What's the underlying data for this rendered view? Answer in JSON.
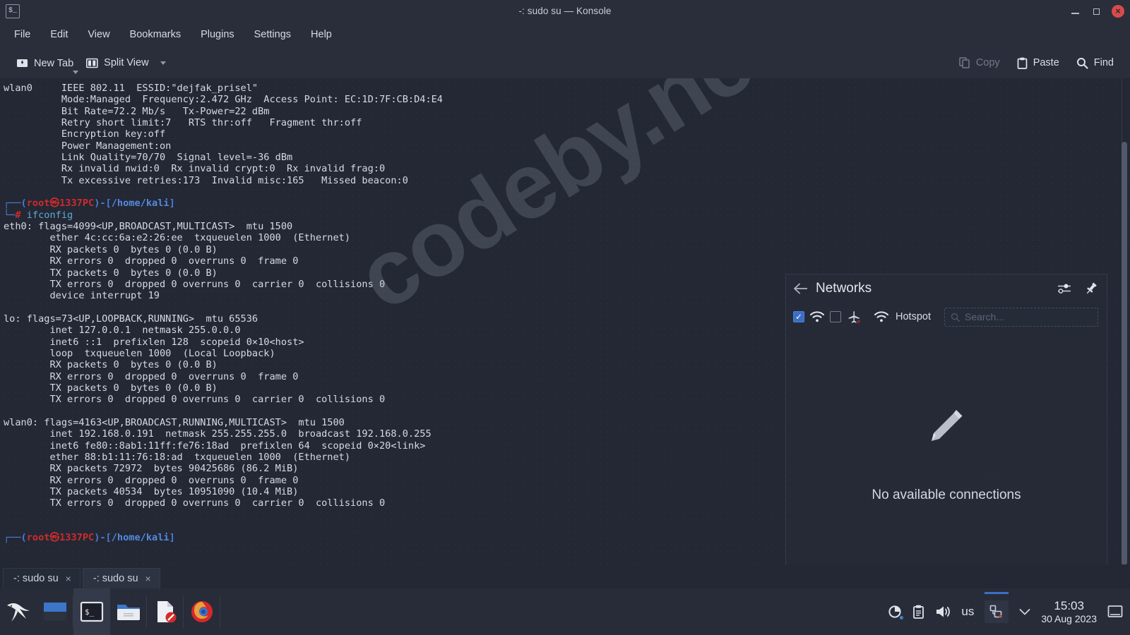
{
  "window": {
    "app_icon": "terminal-icon",
    "title": "-: sudo su — Konsole",
    "minimize": "–",
    "maximize": "□",
    "close": "×"
  },
  "menubar": {
    "items": [
      {
        "label": "File"
      },
      {
        "label": "Edit"
      },
      {
        "label": "View"
      },
      {
        "label": "Bookmarks"
      },
      {
        "label": "Plugins"
      },
      {
        "label": "Settings"
      },
      {
        "label": "Help"
      }
    ]
  },
  "toolbar": {
    "new_tab": "New Tab",
    "split_view": "Split View",
    "copy": "Copy",
    "paste": "Paste",
    "find": "Find"
  },
  "terminal": {
    "lines": [
      {
        "text": "wlan0     IEEE 802.11  ESSID:\"dejfak_prisel\"  "
      },
      {
        "text": "          Mode:Managed  Frequency:2.472 GHz  Access Point: EC:1D:7F:CB:D4:E4   "
      },
      {
        "text": "          Bit Rate=72.2 Mb/s   Tx-Power=22 dBm   "
      },
      {
        "text": "          Retry short limit:7   RTS thr:off   Fragment thr:off"
      },
      {
        "text": "          Encryption key:off"
      },
      {
        "text": "          Power Management:on"
      },
      {
        "text": "          Link Quality=70/70  Signal level=-36 dBm  "
      },
      {
        "text": "          Rx invalid nwid:0  Rx invalid crypt:0  Rx invalid frag:0"
      },
      {
        "text": "          Tx excessive retries:173  Invalid misc:165   Missed beacon:0"
      },
      {
        "text": ""
      },
      {
        "text": "PROMPT1"
      },
      {
        "text": "PROMPT2"
      },
      {
        "text": "eth0: flags=4099<UP,BROADCAST,MULTICAST>  mtu 1500"
      },
      {
        "text": "        ether 4c:cc:6a:e2:26:ee  txqueuelen 1000  (Ethernet)"
      },
      {
        "text": "        RX packets 0  bytes 0 (0.0 B)"
      },
      {
        "text": "        RX errors 0  dropped 0  overruns 0  frame 0"
      },
      {
        "text": "        TX packets 0  bytes 0 (0.0 B)"
      },
      {
        "text": "        TX errors 0  dropped 0 overruns 0  carrier 0  collisions 0"
      },
      {
        "text": "        device interrupt 19  "
      },
      {
        "text": ""
      },
      {
        "text": "lo: flags=73<UP,LOOPBACK,RUNNING>  mtu 65536"
      },
      {
        "text": "        inet 127.0.0.1  netmask 255.0.0.0"
      },
      {
        "text": "        inet6 ::1  prefixlen 128  scopeid 0×10<host>"
      },
      {
        "text": "        loop  txqueuelen 1000  (Local Loopback)"
      },
      {
        "text": "        RX packets 0  bytes 0 (0.0 B)"
      },
      {
        "text": "        RX errors 0  dropped 0  overruns 0  frame 0"
      },
      {
        "text": "        TX packets 0  bytes 0 (0.0 B)"
      },
      {
        "text": "        TX errors 0  dropped 0 overruns 0  carrier 0  collisions 0"
      },
      {
        "text": ""
      },
      {
        "text": "wlan0: flags=4163<UP,BROADCAST,RUNNING,MULTICAST>  mtu 1500"
      },
      {
        "text": "        inet 192.168.0.191  netmask 255.255.255.0  broadcast 192.168.0.255"
      },
      {
        "text": "        inet6 fe80::8ab1:11ff:fe76:18ad  prefixlen 64  scopeid 0×20<link>"
      },
      {
        "text": "        ether 88:b1:11:76:18:ad  txqueuelen 1000  (Ethernet)"
      },
      {
        "text": "        RX packets 72972  bytes 90425686 (86.2 MiB)"
      },
      {
        "text": "        RX errors 0  dropped 0  overruns 0  frame 0"
      },
      {
        "text": "        TX packets 40534  bytes 10951090 (10.4 MiB)"
      },
      {
        "text": "        TX errors 0  dropped 0 overruns 0  carrier 0  collisions 0"
      },
      {
        "text": ""
      },
      {
        "text": ""
      },
      {
        "text": "PROMPT3"
      }
    ],
    "prompt": {
      "top_prefix": "┌──(",
      "user": "root㉿1337PC",
      "mid": ")-[",
      "path": "/home/kali",
      "close": "]",
      "bottom_prefix": "└─",
      "sigil": "#",
      "command": "ifconfig"
    },
    "colors": {
      "background": "#232834",
      "foreground": "#d6dae3",
      "prompt_blue": "#4b7bd4",
      "prompt_red": "#cf2b2b",
      "command_cyan": "#5fa8d6"
    },
    "watermark": "codeby.net"
  },
  "networks_panel": {
    "back_icon": "back-arrow-icon",
    "title": "Networks",
    "settings_icon": "sliders-icon",
    "pin_icon": "pin-icon",
    "wifi_enabled": true,
    "wifi_icon": "wifi-icon",
    "airplane_enabled": false,
    "airplane_icon": "airplane-mode-off-icon",
    "hotspot_icon": "wifi-icon",
    "hotspot_label": "Hotspot",
    "search_placeholder": "Search...",
    "search_value": "",
    "empty_icon": "pencil-icon",
    "empty_text": "No available connections"
  },
  "tabs": [
    {
      "label": "-: sudo su",
      "close": "×",
      "active": false
    },
    {
      "label": "-: sudo su",
      "close": "×",
      "active": true
    }
  ],
  "taskbar": {
    "launchers": [
      {
        "name": "kali-menu-icon"
      },
      {
        "name": "pager-icon"
      },
      {
        "name": "terminal-icon"
      },
      {
        "name": "file-manager-icon"
      },
      {
        "name": "text-editor-icon"
      },
      {
        "name": "firefox-icon"
      }
    ],
    "tray": {
      "updates_icon": "updates-icon",
      "clipboard_icon": "clipboard-icon",
      "volume_icon": "volume-icon",
      "keyboard_layout": "us",
      "network_icon": "network-disconnected-icon",
      "expand_icon": "chevron-down-icon",
      "time": "15:03",
      "date": "30 Aug 2023",
      "show_desktop_icon": "show-desktop-icon"
    }
  }
}
